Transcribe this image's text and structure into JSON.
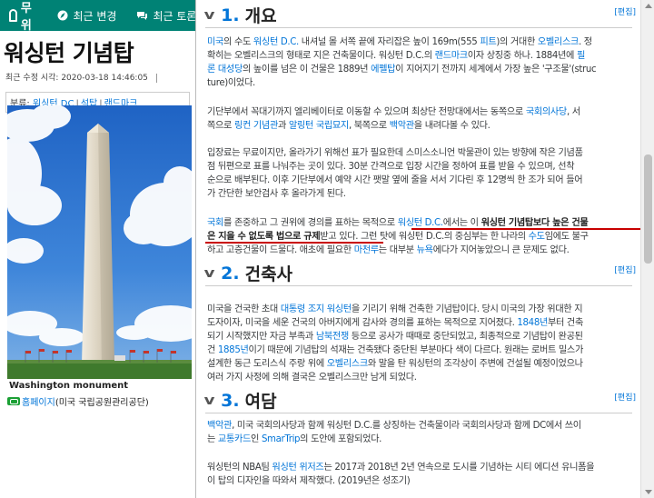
{
  "header": {
    "logo_text": "나무위키",
    "nav": [
      {
        "icon": "compass-icon",
        "label": "최근 변경"
      },
      {
        "icon": "comments-icon",
        "label": "최근 토론"
      }
    ]
  },
  "article": {
    "title": "워싱턴 기념탑",
    "last_modified_label": "최근 수정 시각:",
    "last_modified": "2020-03-18 14:46:05",
    "category_label": "분류:",
    "categories": [
      "워싱턴 DC",
      "석탑",
      "랜드마크"
    ],
    "image_caption": "Washington monument",
    "homepage_label": "홈페이지",
    "homepage_suffix": "(미국 국립공원관리공단)"
  },
  "sections": [
    {
      "num": "1.",
      "title": "개요",
      "edit": "[편집]",
      "paragraphs": [
        [
          [
            [
              "l",
              "미국"
            ],
            [
              "t",
              "의 수도 "
            ],
            [
              "l",
              "워싱턴 D.C."
            ],
            [
              "t",
              " 내셔널 몰 서쪽 끝에 자리잡은 높이 169m(555 "
            ],
            [
              "l",
              "피트"
            ],
            [
              "t",
              ")의 거대한 "
            ],
            [
              "l",
              "오벨리스크"
            ],
            [
              "t",
              ". 정"
            ]
          ],
          [
            [
              "t",
              "확히는 오벨리스크의 형태로 지은 건축물이다. 워싱턴 D.C.의 "
            ],
            [
              "l",
              "랜드마크"
            ],
            [
              "t",
              "이자 상징중 하나. 1884년에 "
            ],
            [
              "l",
              "필"
            ]
          ],
          [
            [
              "l",
              "론 대성당"
            ],
            [
              "t",
              "의 높이를 넘은 이 건물은 1889년 "
            ],
            [
              "l",
              "에펠탑"
            ],
            [
              "t",
              "이 지어지기 전까지 세계에서 가장 높은 '구조물'(struc"
            ]
          ],
          [
            [
              "t",
              "ture)이었다."
            ]
          ]
        ],
        [
          [
            [
              "t",
              "기단부에서 꼭대기까지 엘리베이터로 이동할 수 있으며 최상단 전망대에서는 동쪽으로 "
            ],
            [
              "l",
              "국회의사당"
            ],
            [
              "t",
              ", 서"
            ]
          ],
          [
            [
              "t",
              "쪽으로 "
            ],
            [
              "l",
              "링컨 기념관"
            ],
            [
              "t",
              "과 "
            ],
            [
              "l",
              "알링턴 국립묘지"
            ],
            [
              "t",
              ", 북쪽으로 "
            ],
            [
              "l",
              "백악관"
            ],
            [
              "t",
              "을 내려다볼 수 있다."
            ]
          ]
        ],
        [
          [
            [
              "t",
              "입장료는 무료이지만, 올라가기 위해선 표가 필요한데 스미스소니언 박물관이 있는 방향에 작은 기념품"
            ]
          ],
          [
            [
              "t",
              "점 뒤편으로 표를 나눠주는 곳이 있다. 30분 간격으로 입장 시간을 정하여 표를 받을 수 있으며, 선착"
            ]
          ],
          [
            [
              "t",
              "순으로 배부된다. 이후 기단부에서 예약 시간 팻말 옆에 줄을 서서 기다린 후 12명씩 한 조가 되어 들어"
            ]
          ],
          [
            [
              "t",
              "가 간단한 보안검사 후 올라가게 된다."
            ]
          ]
        ],
        [
          [
            [
              "l",
              "국회"
            ],
            [
              "t",
              "를 존중하고 그 권위에 경의를 표하는 목적으로 "
            ],
            [
              "l",
              "워싱턴 D.C."
            ],
            [
              "t",
              "에서는 이 "
            ],
            [
              "b",
              "워싱턴 기념탑보다 높은 건물"
            ]
          ],
          [
            [
              "b",
              "은 지을 수 없도록 법으로 규제"
            ],
            [
              "t",
              "받고 있다. 그런 탓에 워싱턴 D.C.의 중심부는 한 나라의 "
            ],
            [
              "l",
              "수도"
            ],
            [
              "t",
              "임에도 불구"
            ]
          ],
          [
            [
              "t",
              "하고 고층건물이 드물다. 애초에 필요한 "
            ],
            [
              "l",
              "마천루"
            ],
            [
              "t",
              "는 대부분 "
            ],
            [
              "l",
              "뉴욕"
            ],
            [
              "t",
              "에다가 지어놓았으니 큰 문제도 없다."
            ]
          ]
        ]
      ]
    },
    {
      "num": "2.",
      "title": "건축사",
      "edit": "[편집]",
      "paragraphs": [
        [
          [
            [
              "t",
              "미국을 건국한 초대 "
            ],
            [
              "l",
              "대통령"
            ],
            [
              "t",
              " "
            ],
            [
              "l",
              "조지 워싱턴"
            ],
            [
              "t",
              "을 기리기 위해 건축한 기념탑이다. 당시 미국의 가장 위대한 지"
            ]
          ],
          [
            [
              "t",
              "도자이자, 미국을 세운 건국의 아버지에게 감사와 경의를 표하는 목적으로 지어졌다. "
            ],
            [
              "l",
              "1848년"
            ],
            [
              "t",
              "부터 건축"
            ]
          ],
          [
            [
              "t",
              "되기 시작했지만 자금 부족과 "
            ],
            [
              "l",
              "남북전쟁"
            ],
            [
              "t",
              " 등으로 공사가 때때로 중단되었고, 최종적으로 기념탑이 완공된"
            ]
          ],
          [
            [
              "t",
              "건 "
            ],
            [
              "l",
              "1885년"
            ],
            [
              "t",
              "이기 때문에 기념탑의 석재는 건축됐다 중단된 부분마다 색이 다르다. 원래는 로버트 밀스가"
            ]
          ],
          [
            [
              "t",
              "설계한 동근 도리스식 주랑 위에 "
            ],
            [
              "l",
              "오벨리스크"
            ],
            [
              "t",
              "와 말을 탄 워싱턴의 조각상이 주변에 건설될 예정이었으나"
            ]
          ],
          [
            [
              "t",
              "여러 가지 사정에 의해 결국은 오벨리스크만 남게 되었다."
            ]
          ]
        ]
      ]
    },
    {
      "num": "3.",
      "title": "여담",
      "edit": "[편집]",
      "paragraphs": [
        [
          [
            [
              "l",
              "백악관"
            ],
            [
              "t",
              ", 미국 국회의사당과 함께 워싱턴 D.C.를 상징하는 건축물이라 국회의사당과 함께 DC에서 쓰이"
            ]
          ],
          [
            [
              "t",
              "는 "
            ],
            [
              "l",
              "교통카드"
            ],
            [
              "t",
              "인 "
            ],
            [
              "l",
              "SmarTrip"
            ],
            [
              "t",
              "의 도안에 포함되었다."
            ]
          ]
        ],
        [
          [
            [
              "t",
              "워싱턴의 NBA팀 "
            ],
            [
              "l",
              "워싱턴 위저즈"
            ],
            [
              "t",
              "는 2017과 2018년 2년 연속으로 도시를 기념하는 시티 에디션 유니폼을"
            ]
          ],
          [
            [
              "t",
              "이 탑의 디자인을 따와서 제작했다. (2019년은 성조기)"
            ]
          ]
        ]
      ]
    }
  ],
  "colors": {
    "header": "#008275",
    "link": "#0275d8",
    "highlight_underline": "#c80000",
    "text": "#373a3c"
  }
}
